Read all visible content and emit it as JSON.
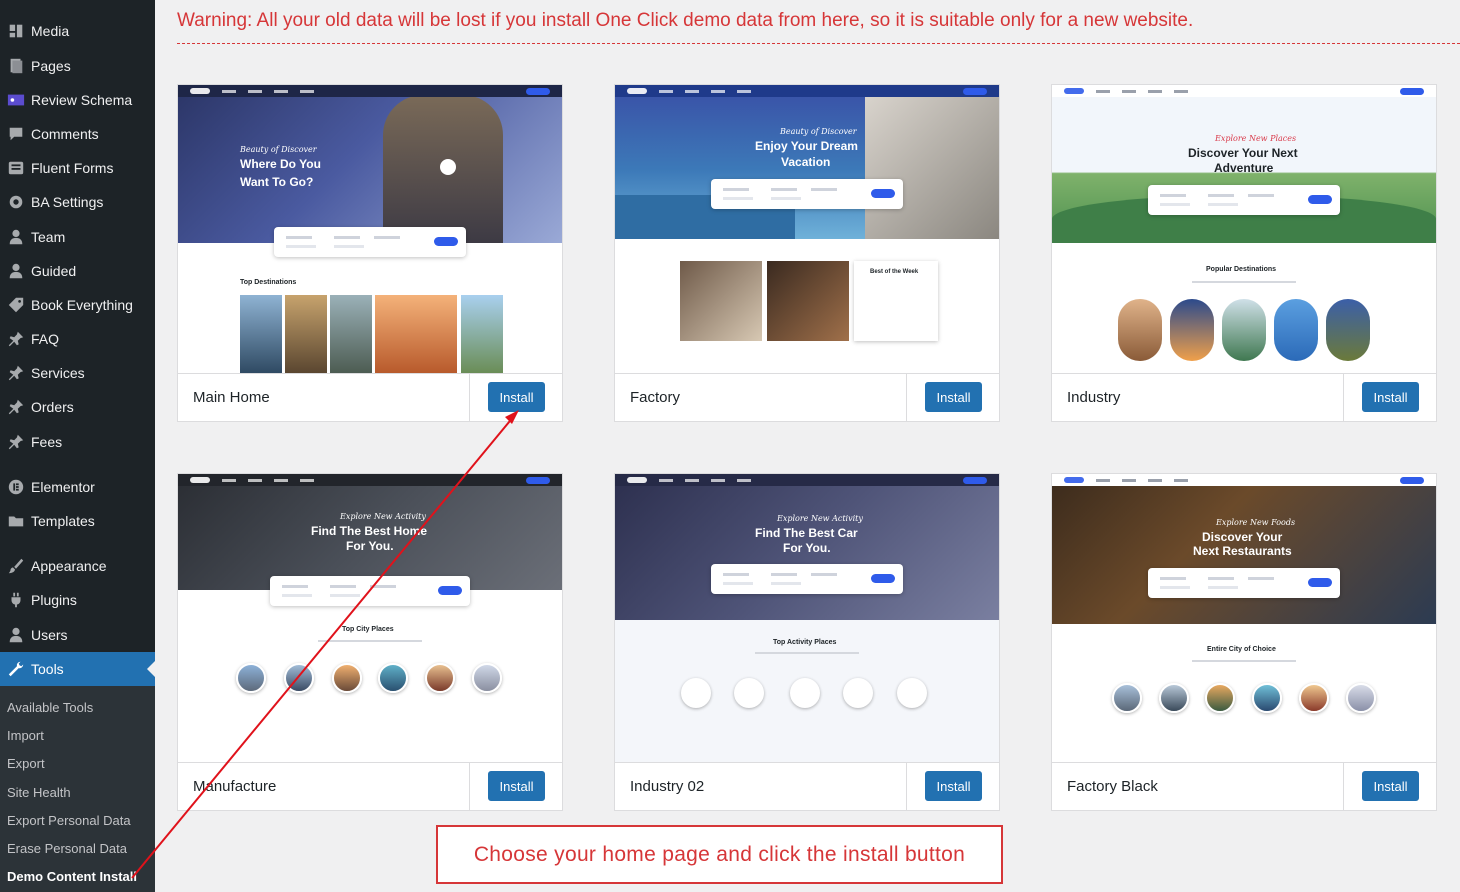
{
  "sidebar": {
    "items": [
      {
        "label": "Media",
        "icon": "media-icon"
      },
      {
        "label": "Pages",
        "icon": "pages-icon"
      },
      {
        "label": "Review Schema",
        "icon": "review-schema-icon"
      },
      {
        "label": "Comments",
        "icon": "comments-icon"
      },
      {
        "label": "Fluent Forms",
        "icon": "forms-icon"
      },
      {
        "label": "BA Settings",
        "icon": "gear-icon"
      },
      {
        "label": "Team",
        "icon": "user-icon"
      },
      {
        "label": "Guided",
        "icon": "user-icon"
      },
      {
        "label": "Book Everything",
        "icon": "tag-icon"
      },
      {
        "label": "FAQ",
        "icon": "pin-icon"
      },
      {
        "label": "Services",
        "icon": "pin-icon"
      },
      {
        "label": "Orders",
        "icon": "pin-icon"
      },
      {
        "label": "Fees",
        "icon": "pin-icon"
      },
      {
        "label": "Elementor",
        "icon": "elementor-icon"
      },
      {
        "label": "Templates",
        "icon": "folder-icon"
      },
      {
        "label": "Appearance",
        "icon": "brush-icon"
      },
      {
        "label": "Plugins",
        "icon": "plug-icon"
      },
      {
        "label": "Users",
        "icon": "user-icon"
      },
      {
        "label": "Tools",
        "icon": "wrench-icon"
      }
    ],
    "submenu": [
      {
        "label": "Available Tools"
      },
      {
        "label": "Import"
      },
      {
        "label": "Export"
      },
      {
        "label": "Site Health"
      },
      {
        "label": "Export Personal Data"
      },
      {
        "label": "Erase Personal Data"
      },
      {
        "label": "Demo Content Install"
      }
    ]
  },
  "main": {
    "warning": "Warning: All your old data will be lost if you install One Click demo data from here, so it is suitable only for a new website.",
    "install_label": "Install",
    "demos": [
      {
        "name": "Main Home",
        "hero_sub": "Beauty of Discover",
        "hero_title_1": "Where Do You",
        "hero_title_2": "Want To Go?",
        "section": "Top Destinations"
      },
      {
        "name": "Factory",
        "hero_sub": "Beauty of Discover",
        "hero_title_1": "Enjoy Your Dream",
        "hero_title_2": "Vacation",
        "section": "Best of the Week"
      },
      {
        "name": "Industry",
        "hero_sub": "Explore New Places",
        "hero_title_1": "Discover Your Next",
        "hero_title_2": "Adventure",
        "section": "Popular Destinations"
      },
      {
        "name": "Manufacture",
        "hero_sub": "Explore New Activity",
        "hero_title_1": "Find The Best Home",
        "hero_title_2": "For You.",
        "section": "Top City Places"
      },
      {
        "name": "Industry 02",
        "hero_sub": "Explore New Activity",
        "hero_title_1": "Find The Best Car",
        "hero_title_2": "For You.",
        "section": "Top Activity Places"
      },
      {
        "name": "Factory Black",
        "hero_sub": "Explore New Foods",
        "hero_title_1": "Discover Your",
        "hero_title_2": "Next Restaurants",
        "section": "Entire City of Choice"
      }
    ],
    "note": "Choose your home page and click the install button"
  },
  "colors": {
    "accent": "#2271b1",
    "warning": "#d63638",
    "sidebar": "#1d2327"
  }
}
